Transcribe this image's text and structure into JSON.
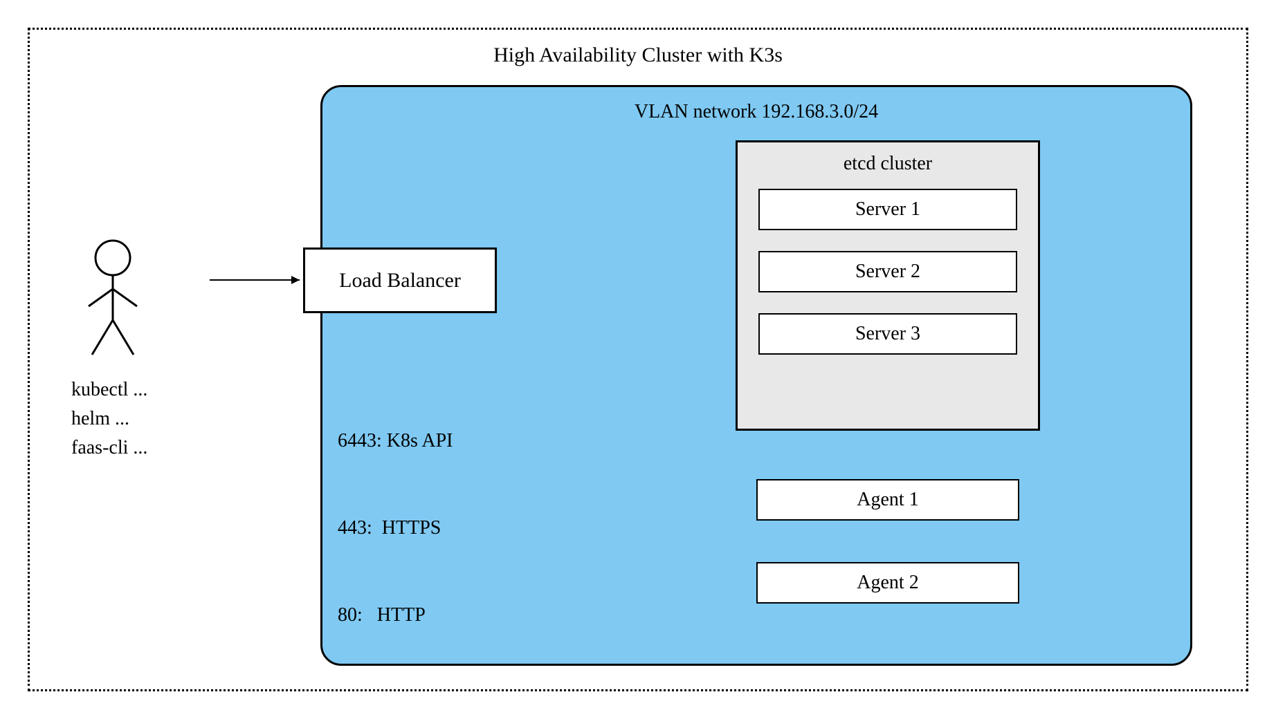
{
  "title": "High Availability Cluster with K3s",
  "vlan": {
    "title": "VLAN network 192.168.3.0/24"
  },
  "loadBalancer": {
    "label": "Load Balancer"
  },
  "ports": {
    "line1": "6443: K8s API",
    "line2": "443:  HTTPS",
    "line3": "80:   HTTP"
  },
  "etcdCluster": {
    "title": "etcd cluster",
    "servers": [
      "Server 1",
      "Server 2",
      "Server 3"
    ]
  },
  "agents": [
    "Agent 1",
    "Agent 2"
  ],
  "user": {
    "commands": [
      "kubectl ...",
      "helm ...",
      "faas-cli ..."
    ]
  }
}
